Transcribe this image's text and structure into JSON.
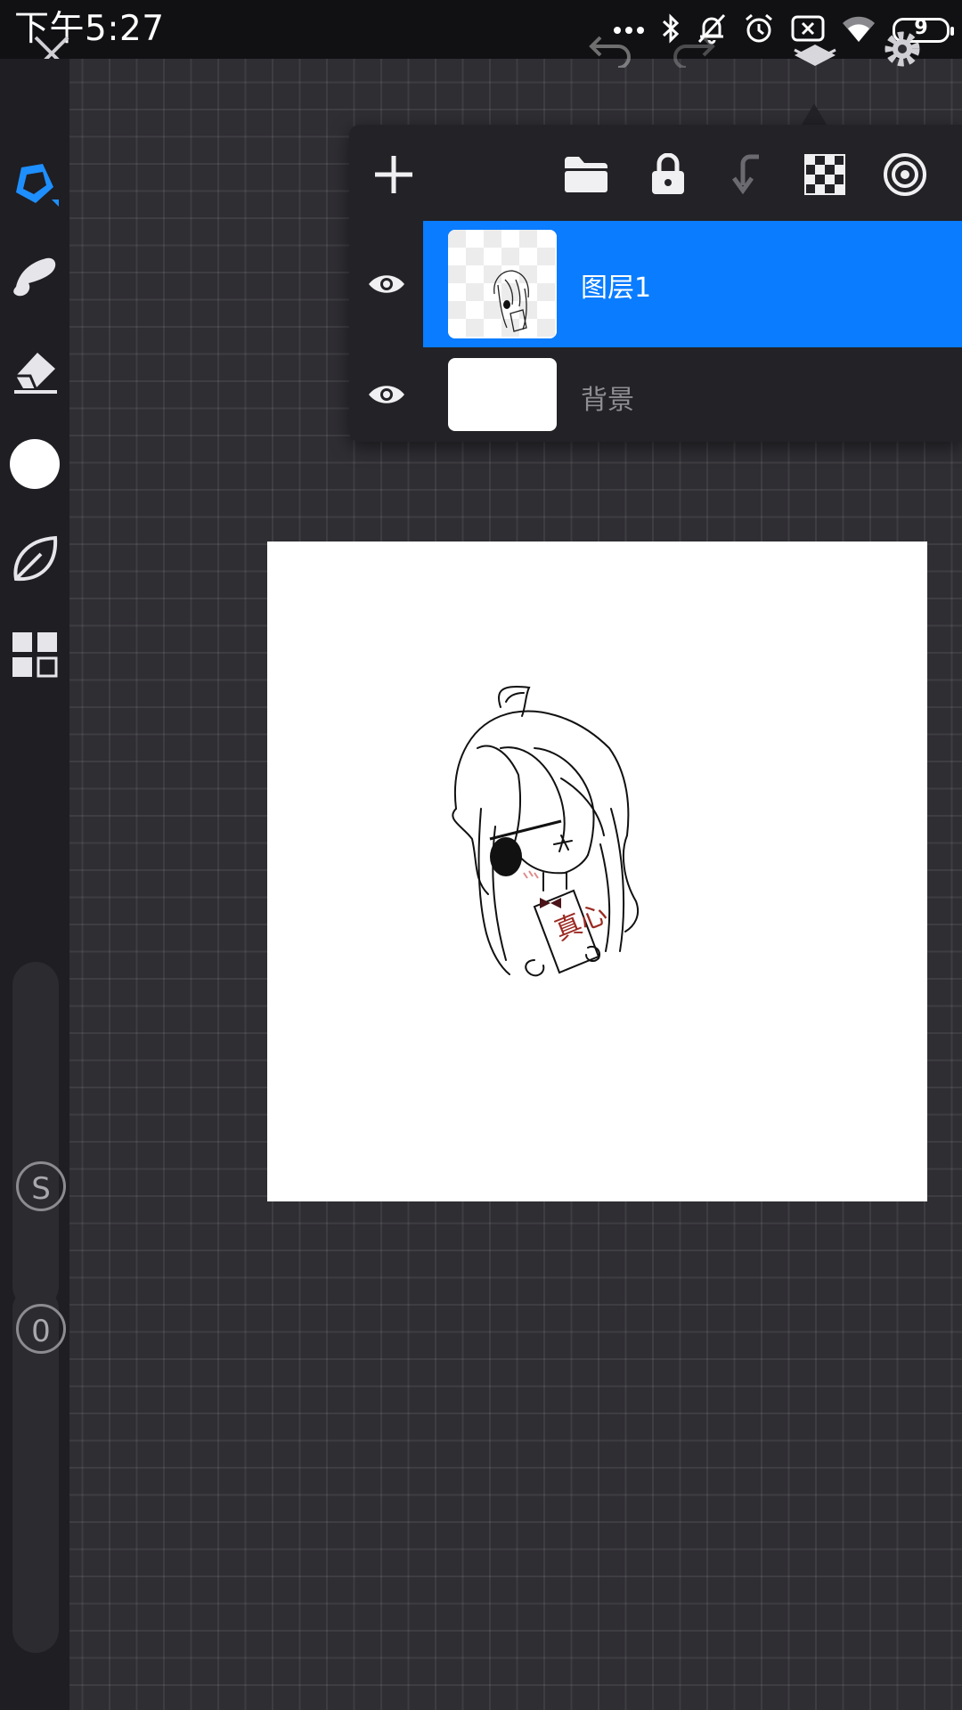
{
  "status_bar": {
    "time": "下午5:27",
    "battery": "9",
    "icons": [
      "more-dots-icon",
      "bluetooth-icon",
      "mute-bell-icon",
      "alarm-icon",
      "sim-x-icon",
      "wifi-icon",
      "battery-icon"
    ]
  },
  "top_bar": {
    "icons": [
      "close-icon",
      "undo-icon",
      "redo-icon",
      "layers-icon",
      "settings-icon"
    ]
  },
  "left_toolbar": {
    "tools": [
      "pen-icon",
      "smudge-icon",
      "eraser-icon",
      "color-swatch",
      "leaf-icon",
      "grid-icon"
    ],
    "active_color": "#ffffff",
    "accent": "#1e8fff",
    "size_badge": "S",
    "opacity_badge": "0"
  },
  "layers_panel": {
    "toolbar_icons": [
      "add-layer-icon",
      "folder-icon",
      "lock-icon",
      "merge-down-icon",
      "transparency-icon",
      "blend-icon"
    ],
    "layers": [
      {
        "name": "图层1",
        "selected": true
      },
      {
        "name": "背景",
        "selected": false
      }
    ],
    "selected_color": "#0a7cff"
  },
  "artwork": {
    "sign_text": "真心"
  }
}
